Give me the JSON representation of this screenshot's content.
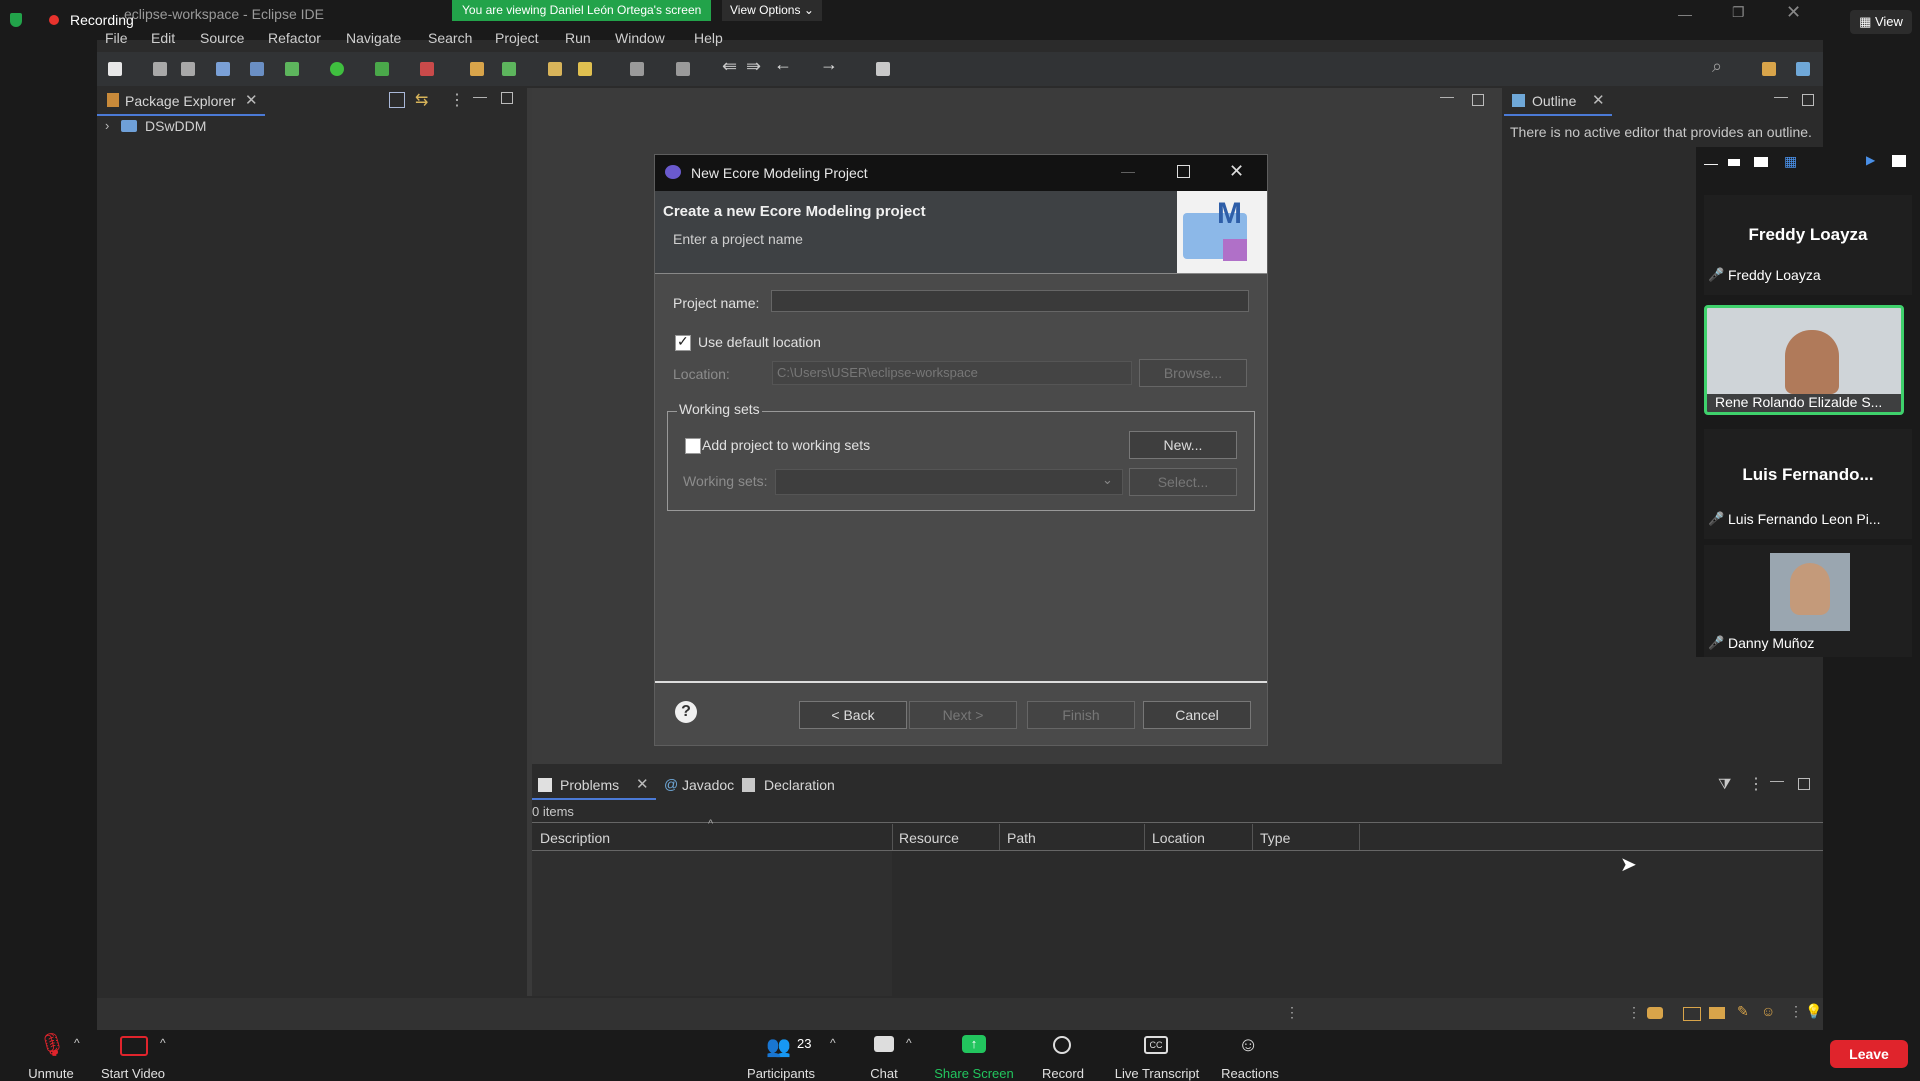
{
  "zoom": {
    "recording_label": "Recording",
    "viewing_banner": "You are viewing Daniel León Ortega's screen",
    "view_options": "View Options",
    "view_label": "View",
    "bottom": {
      "unmute": "Unmute",
      "start_video": "Start Video",
      "participants": "Participants",
      "participants_count": "23",
      "chat": "Chat",
      "share_screen": "Share Screen",
      "record": "Record",
      "live_transcript": "Live Transcript",
      "reactions": "Reactions",
      "leave": "Leave"
    },
    "participants_list": [
      {
        "title": "Freddy Loayza",
        "name": "Freddy Loayza"
      },
      {
        "name": "Rene Rolando Elizalde S..."
      },
      {
        "title": "Luis Fernando...",
        "name": "Luis Fernando Leon Pi..."
      },
      {
        "name": "Danny Muñoz"
      }
    ],
    "colors": {
      "banner": "#22a34a",
      "leave": "#e0242c",
      "share": "#22c55e",
      "active_border": "#3fd16c"
    }
  },
  "eclipse": {
    "window_title": "eclipse-workspace - Eclipse IDE",
    "menu": [
      "File",
      "Edit",
      "Source",
      "Refactor",
      "Navigate",
      "Search",
      "Project",
      "Run",
      "Window",
      "Help"
    ],
    "package_explorer": {
      "tab": "Package Explorer",
      "project": "DSwDDM"
    },
    "outline": {
      "tab": "Outline",
      "message": "There is no active editor that provides an outline."
    },
    "bottom_tabs": {
      "problems": "Problems",
      "javadoc": "Javadoc",
      "declaration": "Declaration"
    },
    "problems": {
      "count": "0 items",
      "columns": [
        "Description",
        "Resource",
        "Path",
        "Location",
        "Type"
      ]
    }
  },
  "dialog": {
    "title": "New Ecore Modeling Project",
    "heading": "Create a new Ecore Modeling project",
    "subheading": "Enter a project name",
    "project_name_label": "Project name:",
    "project_name_value": "",
    "use_default_label": "Use default location",
    "use_default_checked": true,
    "location_label": "Location:",
    "location_value": "C:\\Users\\USER\\eclipse-workspace",
    "browse": "Browse...",
    "working_sets_group": "Working sets",
    "add_to_ws_label": "Add project to working sets",
    "new_button": "New...",
    "working_sets_label": "Working sets:",
    "select_button": "Select...",
    "back": "< Back",
    "next": "Next >",
    "finish": "Finish",
    "cancel": "Cancel"
  }
}
